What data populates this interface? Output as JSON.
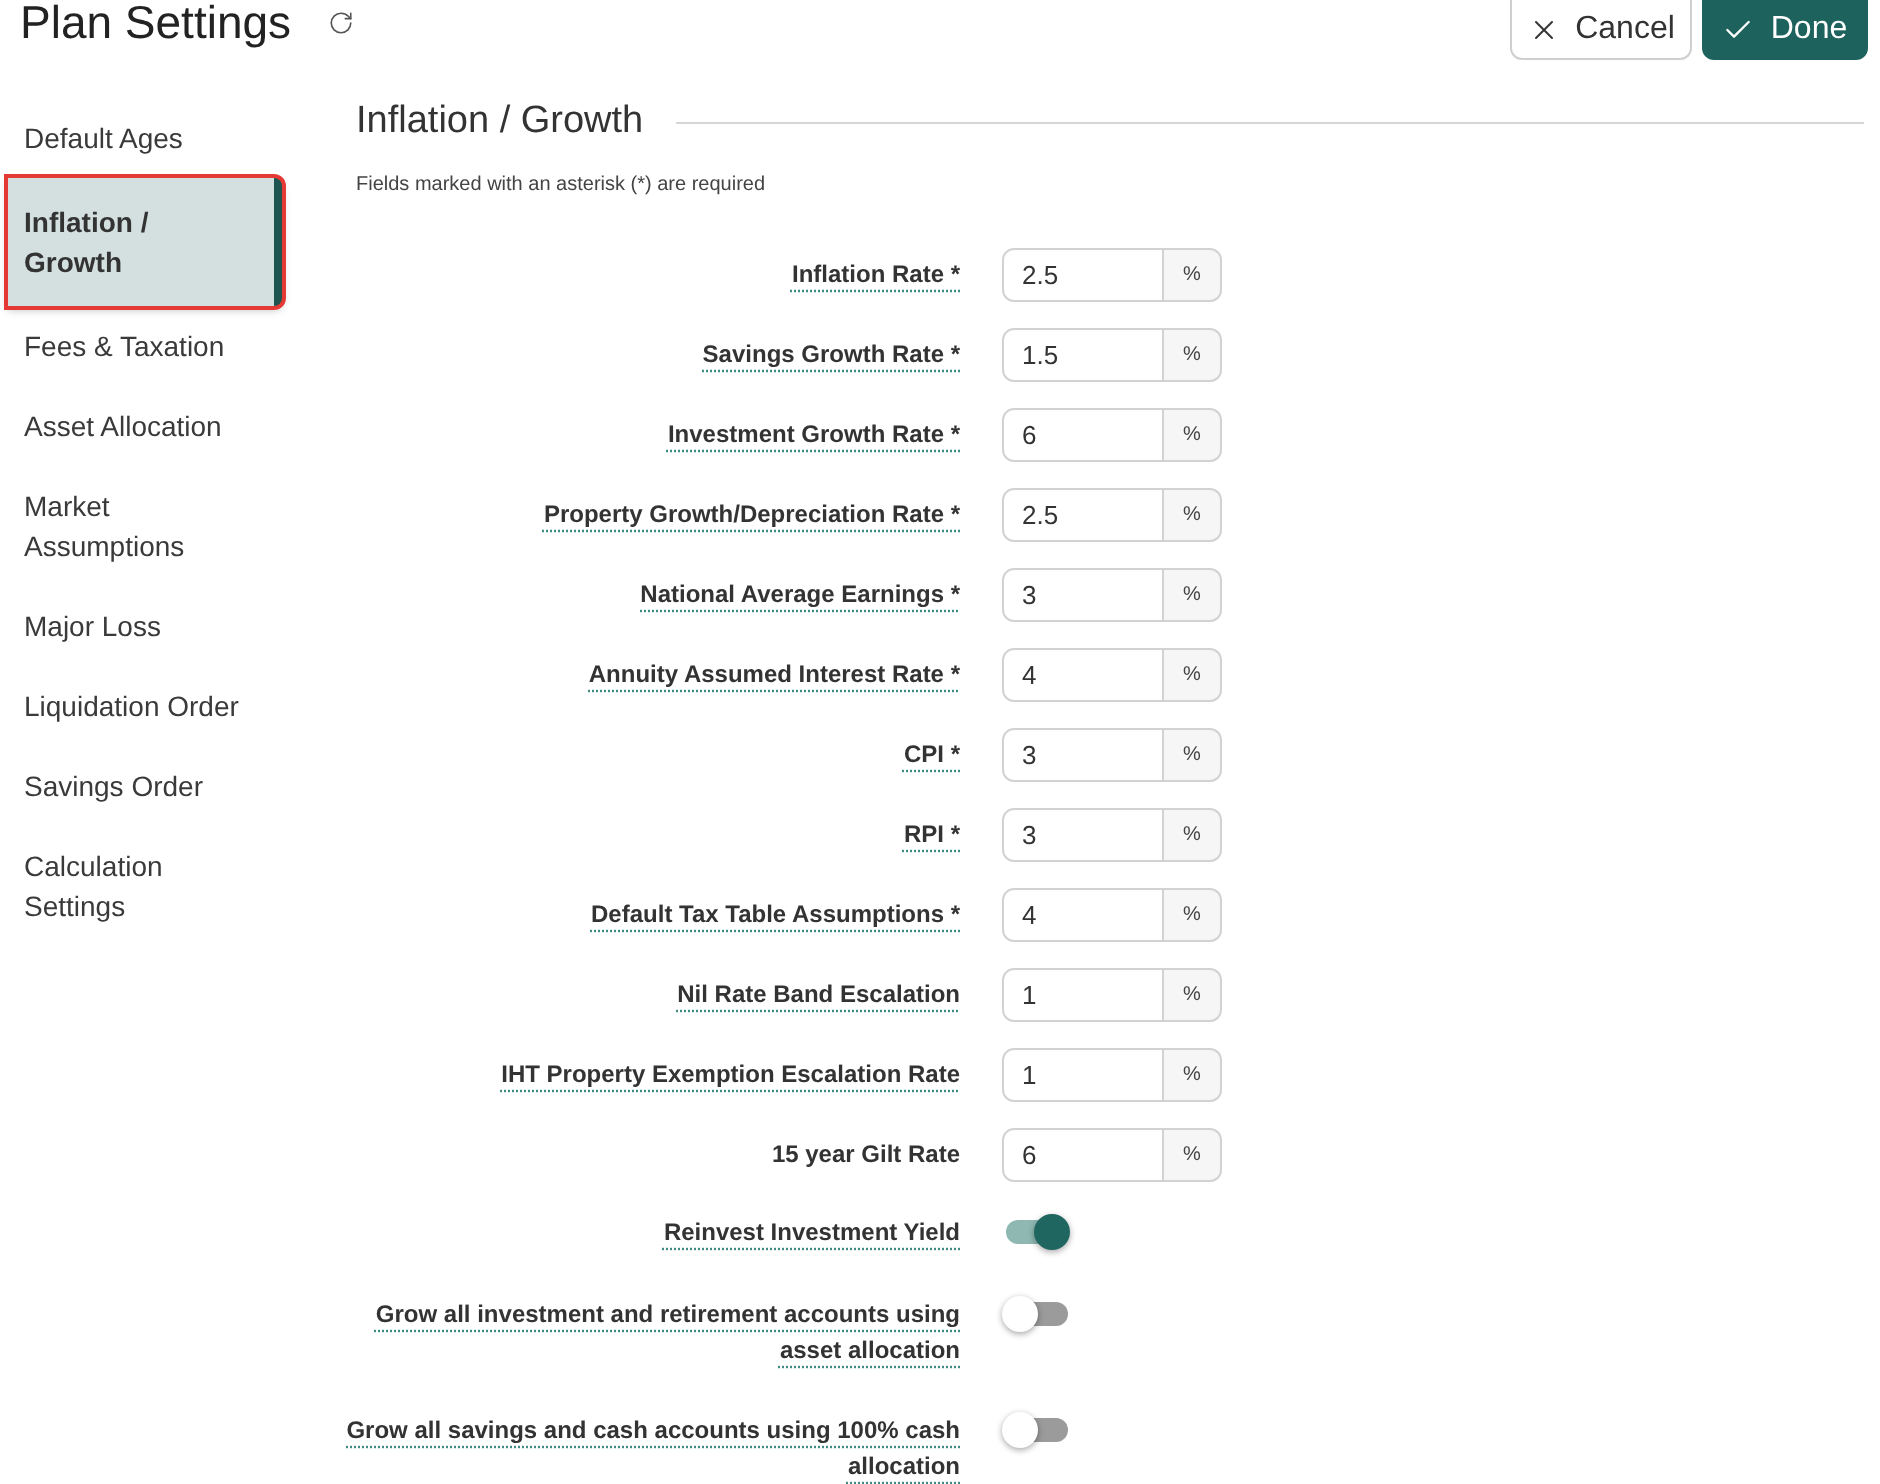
{
  "header": {
    "title": "Plan Settings",
    "buttons": [
      {
        "kind": "cancel",
        "label": "Cancel"
      },
      {
        "kind": "done",
        "label": "Done"
      }
    ]
  },
  "sidebar": {
    "items": [
      {
        "label": "Default Ages",
        "selected": false,
        "highlighted": false
      },
      {
        "label": "Inflation / Growth",
        "selected": true,
        "highlighted": true
      },
      {
        "label": "Fees & Taxation",
        "selected": false,
        "highlighted": false
      },
      {
        "label": "Asset Allocation",
        "selected": false,
        "highlighted": false
      },
      {
        "label": "Market Assumptions",
        "selected": false,
        "highlighted": false
      },
      {
        "label": "Major Loss",
        "selected": false,
        "highlighted": false
      },
      {
        "label": "Liquidation Order",
        "selected": false,
        "highlighted": false
      },
      {
        "label": "Savings Order",
        "selected": false,
        "highlighted": false
      },
      {
        "label": "Calculation Settings",
        "selected": false,
        "highlighted": false
      }
    ]
  },
  "section": {
    "title": "Inflation / Growth",
    "note": "Fields marked with an asterisk (*) are required",
    "fields": [
      {
        "kind": "rate",
        "label": "Inflation Rate *",
        "hint": true,
        "value": "2.5",
        "unit": "%"
      },
      {
        "kind": "rate",
        "label": "Savings Growth Rate *",
        "hint": true,
        "value": "1.5",
        "unit": "%"
      },
      {
        "kind": "rate",
        "label": "Investment Growth Rate *",
        "hint": true,
        "value": "6",
        "unit": "%"
      },
      {
        "kind": "rate",
        "label": "Property Growth/Depreciation Rate *",
        "hint": true,
        "value": "2.5",
        "unit": "%"
      },
      {
        "kind": "rate",
        "label": "National Average Earnings *",
        "hint": true,
        "value": "3",
        "unit": "%"
      },
      {
        "kind": "rate",
        "label": "Annuity Assumed Interest Rate *",
        "hint": true,
        "value": "4",
        "unit": "%"
      },
      {
        "kind": "rate",
        "label": "CPI *",
        "hint": true,
        "value": "3",
        "unit": "%"
      },
      {
        "kind": "rate",
        "label": "RPI *",
        "hint": true,
        "value": "3",
        "unit": "%"
      },
      {
        "kind": "rate",
        "label": "Default Tax Table Assumptions *",
        "hint": true,
        "value": "4",
        "unit": "%"
      },
      {
        "kind": "rate",
        "label": "Nil Rate Band Escalation",
        "hint": true,
        "value": "1",
        "unit": "%"
      },
      {
        "kind": "rate",
        "label": "IHT Property Exemption Escalation Rate",
        "hint": true,
        "value": "1",
        "unit": "%"
      },
      {
        "kind": "rate",
        "label": "15 year Gilt Rate",
        "hint": false,
        "value": "6",
        "unit": "%"
      },
      {
        "kind": "toggle",
        "label": "Reinvest Investment Yield",
        "hint": true,
        "on": true
      },
      {
        "kind": "toggle",
        "label": "Grow all investment and retirement accounts using asset allocation",
        "hint": true,
        "on": false
      },
      {
        "kind": "toggle",
        "label": "Grow all savings and cash accounts using 100% cash allocation",
        "hint": true,
        "on": false
      }
    ]
  }
}
